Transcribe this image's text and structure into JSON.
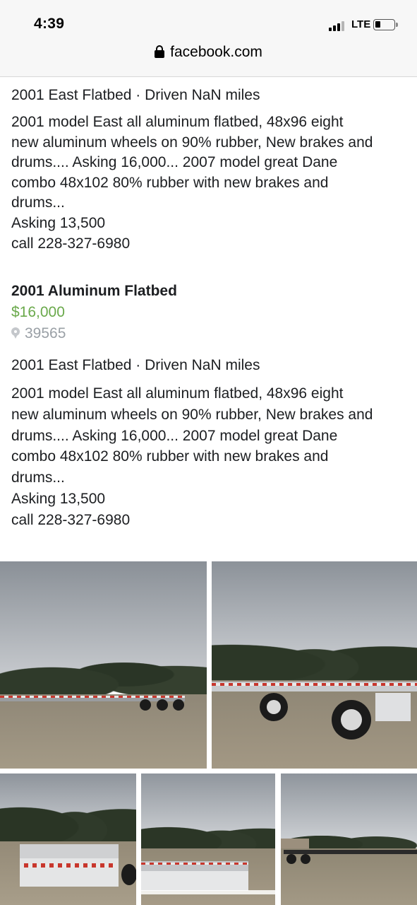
{
  "status_bar": {
    "time": "4:39",
    "network": "LTE",
    "battery_icon": "battery-icon",
    "signal_icon": "signal-bars-icon"
  },
  "browser": {
    "url": "facebook.com",
    "lock_icon": "lock-icon"
  },
  "listing_top": {
    "meta": "2001 East Flatbed · Driven NaN miles",
    "description": [
      "2001 model East all aluminum flatbed, 48x96 eight",
      "new aluminum wheels on 90% rubber, New brakes and",
      "drums.... Asking 16,000... 2007 model great Dane",
      "combo 48x102 80% rubber with new brakes and",
      "drums...",
      "Asking 13,500",
      "call 228-327-6980"
    ]
  },
  "listing": {
    "title": "2001 Aluminum Flatbed",
    "price": "$16,000",
    "location": "39565",
    "meta": "2001 East Flatbed · Driven NaN miles",
    "description": [
      "2001 model East all aluminum flatbed, 48x96 eight",
      "new aluminum wheels on 90% rubber, New brakes and",
      "drums.... Asking 16,000... 2007 model great Dane",
      "combo 48x102 80% rubber with new brakes and",
      "drums...",
      "Asking 13,500",
      "call 228-327-6980"
    ]
  },
  "colors": {
    "price": "#6aa94b",
    "location": "#9aa0a6",
    "text": "#1c1e21"
  },
  "photos": [
    "listing-photo-1",
    "listing-photo-2",
    "listing-photo-3",
    "listing-photo-4",
    "listing-photo-5"
  ]
}
